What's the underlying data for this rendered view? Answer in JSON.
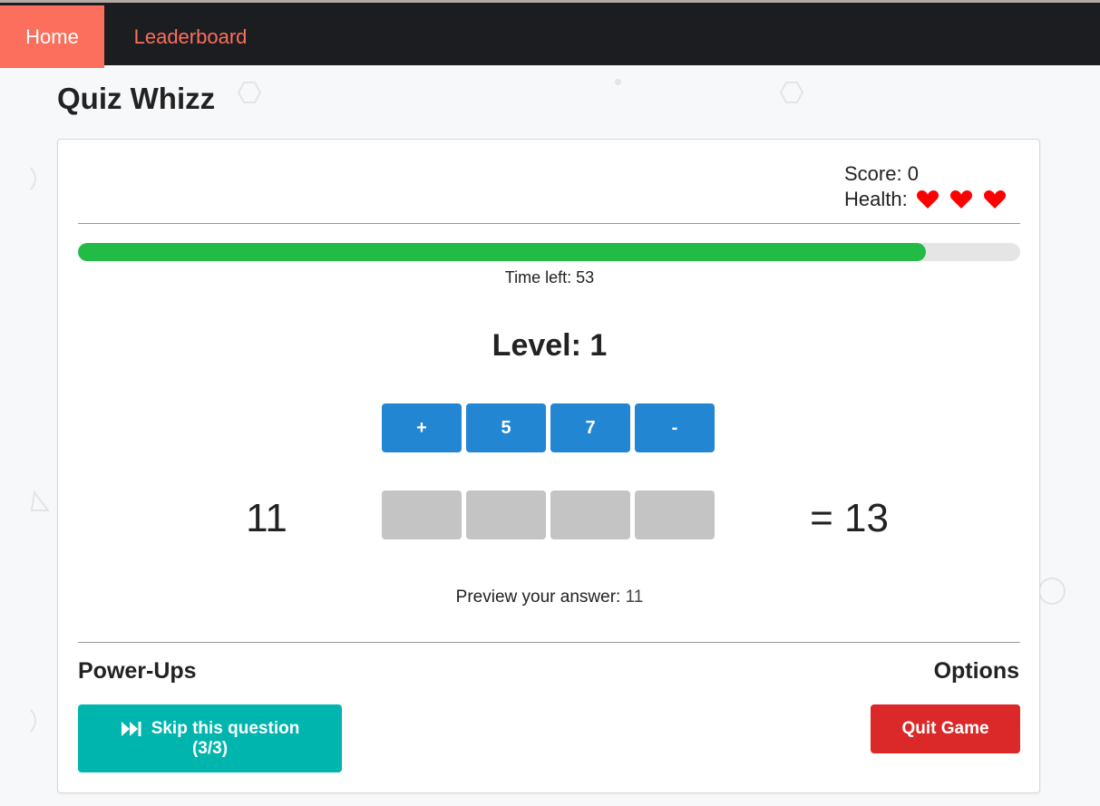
{
  "nav": {
    "home_label": "Home",
    "leaderboard_label": "Leaderboard"
  },
  "page": {
    "title": "Quiz Whizz"
  },
  "stats": {
    "score_label": "Score:",
    "score_value": "0",
    "health_label": "Health:",
    "hearts": 3
  },
  "timer": {
    "label": "Time left:",
    "value": "53",
    "fraction_remaining": 0.9
  },
  "level": {
    "label": "Level:",
    "value": "1"
  },
  "operand_tiles": [
    "+",
    "5",
    "7",
    "-"
  ],
  "answer_slots": [
    "",
    "",
    "",
    ""
  ],
  "equation": {
    "start": "11",
    "target": "= 13"
  },
  "preview": {
    "label": "Preview your answer:",
    "value": "11"
  },
  "powerups": {
    "heading": "Power-Ups",
    "skip_label": "Skip this question",
    "skip_count": "(3/3)"
  },
  "options": {
    "heading": "Options",
    "quit_label": "Quit Game"
  },
  "colors": {
    "accent": "#fb6f5c",
    "progress": "#22bb46",
    "tile_blue": "#2386d2",
    "slot_gray": "#c4c4c4",
    "skip_teal": "#00b5ad",
    "quit_red": "#db2828",
    "heart_red": "#ff0000"
  }
}
